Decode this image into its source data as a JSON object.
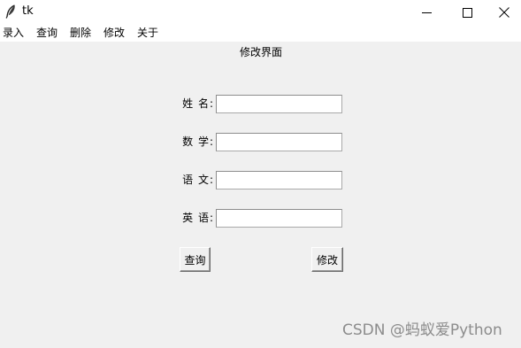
{
  "window": {
    "title": "tk",
    "app_icon": "feather-icon",
    "controls": {
      "minimize_icon": "minimize-icon",
      "maximize_icon": "maximize-icon",
      "close_icon": "close-icon"
    }
  },
  "menubar": {
    "items": [
      {
        "label": "录入"
      },
      {
        "label": "查询"
      },
      {
        "label": "删除"
      },
      {
        "label": "修改"
      },
      {
        "label": "关于"
      }
    ]
  },
  "form": {
    "title": "修改界面",
    "fields": [
      {
        "label": "姓 名:",
        "value": ""
      },
      {
        "label": "数 学:",
        "value": ""
      },
      {
        "label": "语 文:",
        "value": ""
      },
      {
        "label": "英 语:",
        "value": ""
      }
    ],
    "buttons": {
      "query_label": "查询",
      "modify_label": "修改"
    }
  },
  "watermark": "CSDN @蚂蚁爱Python"
}
